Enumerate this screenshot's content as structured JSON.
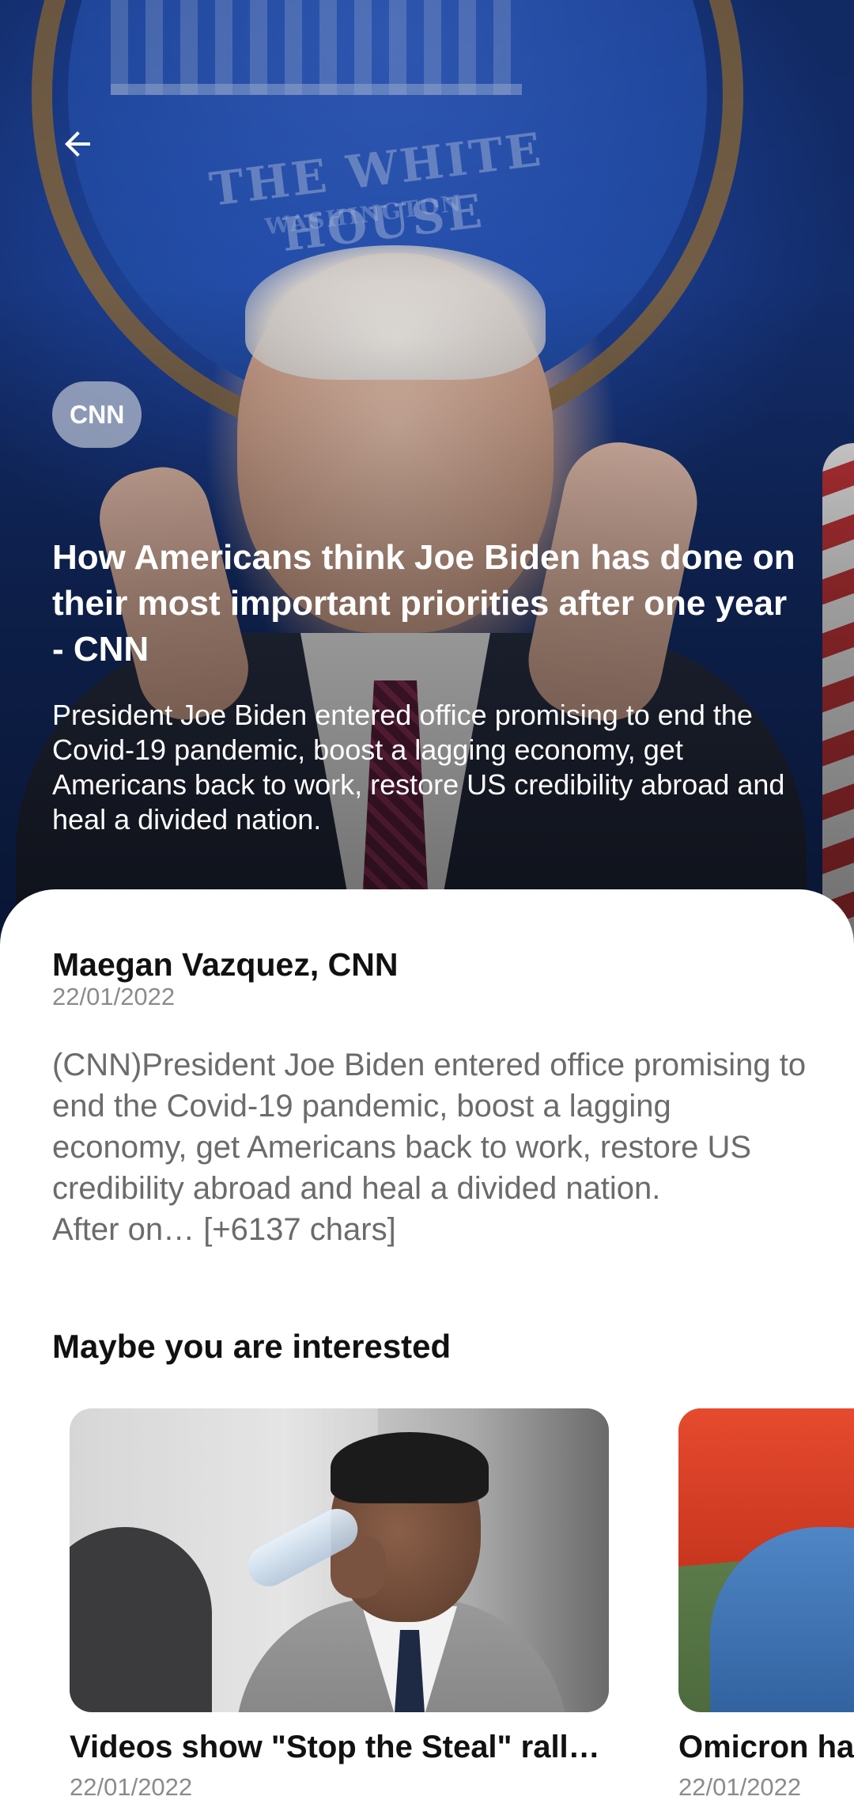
{
  "hero": {
    "back_icon": "arrow-left-icon",
    "source_badge": "CNN",
    "title": "How Americans think Joe Biden has done on their most important priorities after one year - CNN",
    "description": "President Joe Biden entered office promising to end the Covid-19 pandemic, boost a lagging economy, get Americans back to work, restore US credibility abroad and heal a divided nation."
  },
  "article": {
    "author": "Maegan Vazquez, CNN",
    "date": "22/01/2022",
    "content": "(CNN)President Joe Biden entered office promising to end the Covid-19 pandemic, boost a lagging economy, get Americans back to work, restore US credibility abroad and heal a divided nation.\nAfter on… [+6137 chars]"
  },
  "related": {
    "section_title": "Maybe you are interested",
    "items": [
      {
        "title": "Videos show \"Stop the Steal\" rally organizer Ali Alexander",
        "date": "22/01/2022"
      },
      {
        "title": "Omicron has arrived",
        "date": "22/01/2022"
      }
    ]
  },
  "colors": {
    "hero_text": "#ffffff",
    "badge_bg": "#b4bccd",
    "body_text": "#6b6b6b",
    "heading_text": "#111111",
    "muted_text": "#8b8b8b"
  }
}
